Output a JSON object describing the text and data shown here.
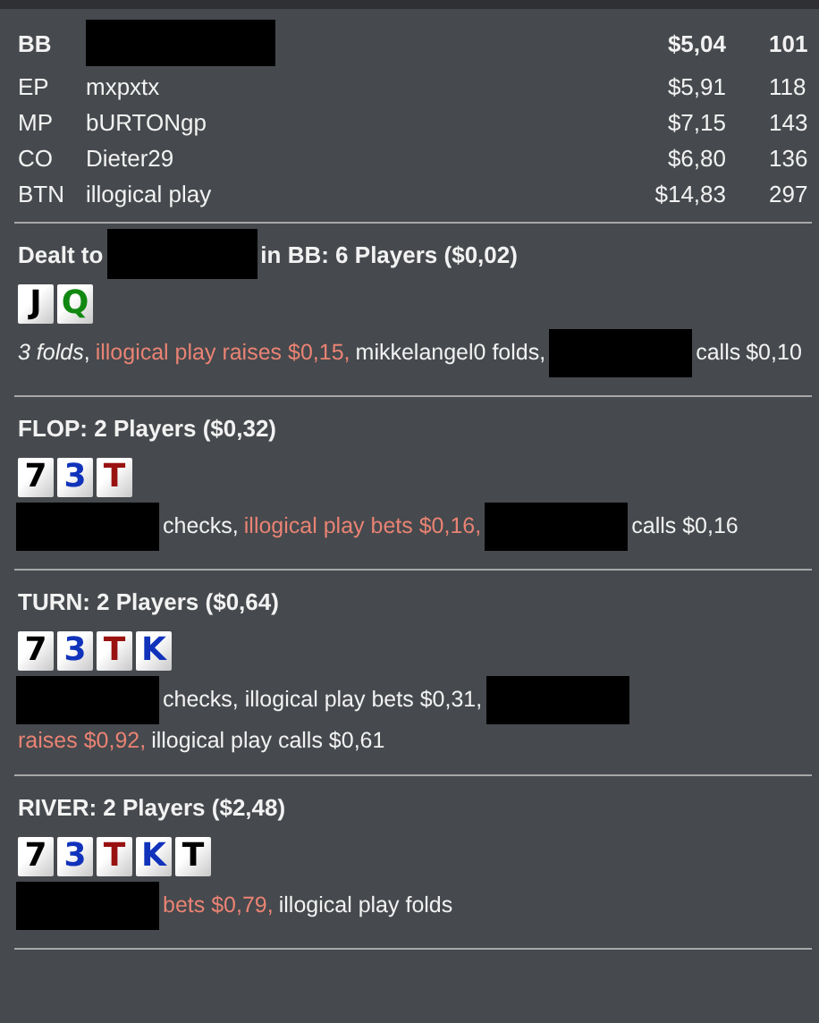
{
  "players": [
    {
      "position": "BB",
      "name_redacted": true,
      "stack": "$5,04",
      "bb": "101",
      "hero": true
    },
    {
      "position": "EP",
      "name_redacted": false,
      "name": "mxpxtx",
      "stack": "$5,91",
      "bb": "118",
      "hero": false
    },
    {
      "position": "MP",
      "name_redacted": false,
      "name": "bURTONgp",
      "stack": "$7,15",
      "bb": "143",
      "hero": false
    },
    {
      "position": "CO",
      "name_redacted": false,
      "name": "Dieter29",
      "stack": "$6,80",
      "bb": "136",
      "hero": false
    },
    {
      "position": "BTN",
      "name_redacted": false,
      "name": "illogical play",
      "stack": "$14,83",
      "bb": "297",
      "hero": false
    }
  ],
  "streets": [
    {
      "header": [
        {
          "kind": "text",
          "text": "Dealt to"
        },
        {
          "kind": "redacted"
        },
        {
          "kind": "text",
          "text": "in BB: 6 Players ($0,02)"
        }
      ],
      "cards": [
        {
          "rank": "J",
          "color": "#000000"
        },
        {
          "rank": "Q",
          "color": "#118811"
        }
      ],
      "actions": [
        {
          "kind": "text",
          "text": "*3 folds*,",
          "highlight": false
        },
        {
          "kind": "text",
          "text": "illogical play raises $0,15,",
          "highlight": true
        },
        {
          "kind": "text",
          "text": "mikkelangel0 folds,",
          "highlight": false
        },
        {
          "kind": "redacted"
        },
        {
          "kind": "text",
          "text": "calls",
          "highlight": false
        },
        {
          "kind": "text",
          "text": "$0,10",
          "highlight": false
        }
      ]
    },
    {
      "header": [
        {
          "kind": "text",
          "text": "FLOP: 2 Players ($0,32)"
        }
      ],
      "cards": [
        {
          "rank": "7",
          "color": "#000000"
        },
        {
          "rank": "3",
          "color": "#1133bb"
        },
        {
          "rank": "T",
          "color": "#991111"
        }
      ],
      "actions": [
        {
          "kind": "redacted"
        },
        {
          "kind": "text",
          "text": "checks,",
          "highlight": false
        },
        {
          "kind": "text",
          "text": "illogical play bets $0,16,",
          "highlight": true
        },
        {
          "kind": "redacted"
        },
        {
          "kind": "text",
          "text": "calls $0,16",
          "highlight": false
        }
      ]
    },
    {
      "header": [
        {
          "kind": "text",
          "text": "TURN: 2 Players ($0,64)"
        }
      ],
      "cards": [
        {
          "rank": "7",
          "color": "#000000"
        },
        {
          "rank": "3",
          "color": "#1133bb"
        },
        {
          "rank": "T",
          "color": "#991111"
        },
        {
          "rank": "K",
          "color": "#1133bb"
        }
      ],
      "actions": [
        {
          "kind": "redacted"
        },
        {
          "kind": "text",
          "text": "checks, illogical play bets $0,31,",
          "highlight": false
        },
        {
          "kind": "redacted"
        },
        {
          "kind": "text",
          "text": "raises $0,92,",
          "highlight": true
        },
        {
          "kind": "text",
          "text": "illogical play calls $0,61",
          "highlight": false
        }
      ]
    },
    {
      "header": [
        {
          "kind": "text",
          "text": "RIVER: 2 Players ($2,48)"
        }
      ],
      "cards": [
        {
          "rank": "7",
          "color": "#000000"
        },
        {
          "rank": "3",
          "color": "#1133bb"
        },
        {
          "rank": "T",
          "color": "#991111"
        },
        {
          "rank": "K",
          "color": "#1133bb"
        },
        {
          "rank": "T",
          "color": "#000000"
        }
      ],
      "actions": [
        {
          "kind": "redacted"
        },
        {
          "kind": "text",
          "text": "bets $0,79,",
          "highlight": true
        },
        {
          "kind": "text",
          "text": "illogical play folds",
          "highlight": false
        }
      ]
    }
  ]
}
